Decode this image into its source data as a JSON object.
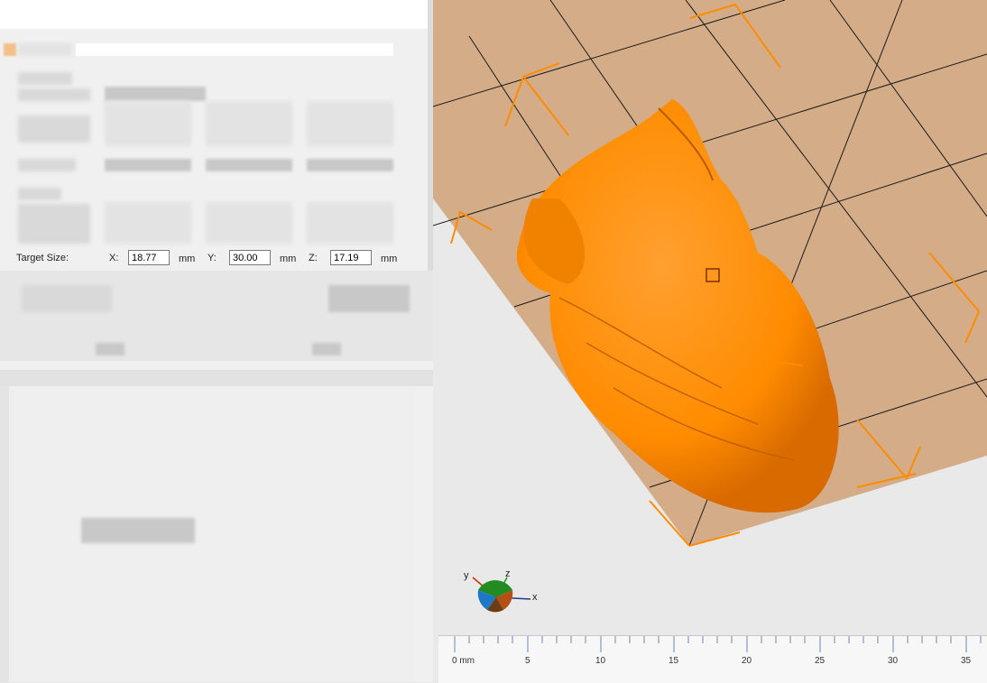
{
  "dialog": {
    "target_size_label": "Target Size:",
    "x_label": "X:",
    "x_value": "18.77",
    "y_label": "Y:",
    "y_value": "30.00",
    "z_label": "Z:",
    "z_value": "17.19",
    "unit": "mm"
  },
  "viewport": {
    "model_color": "#ff8c00",
    "bed_color": "#d4ac88",
    "gizmo": {
      "x": "x",
      "y": "y",
      "z": "z"
    },
    "ruler": {
      "ticks": [
        "0 mm",
        "5",
        "10",
        "15",
        "20",
        "25",
        "30",
        "35"
      ]
    }
  }
}
